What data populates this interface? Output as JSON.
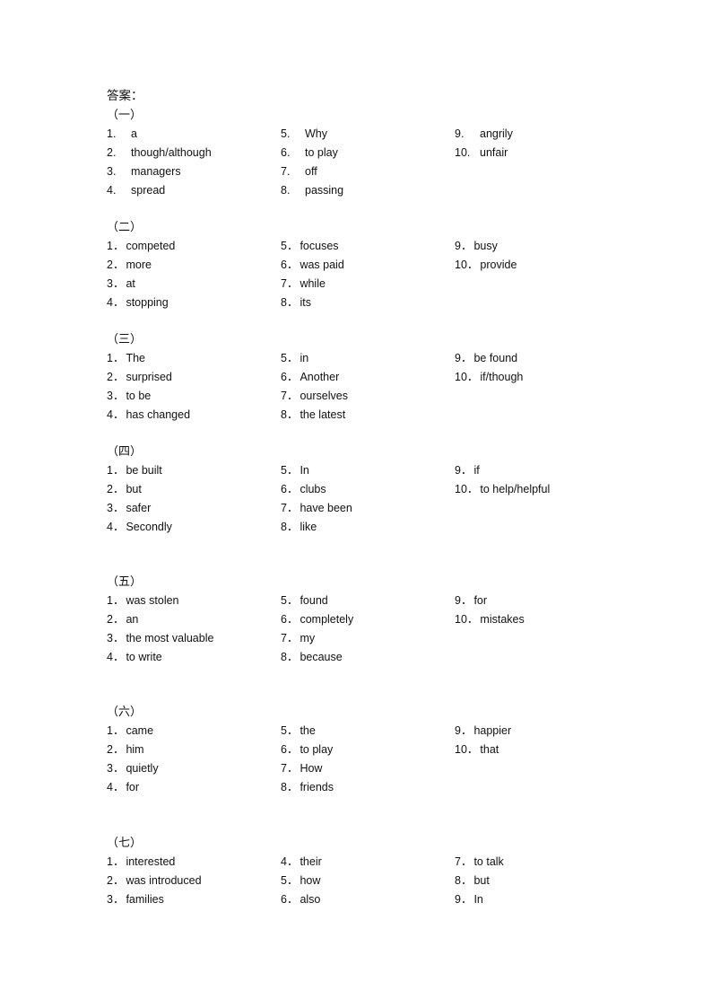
{
  "document": {
    "heading": "答案：",
    "sections": [
      {
        "title": "（一）",
        "style": "A",
        "items": [
          {
            "num": "1.",
            "answer": "a"
          },
          {
            "num": "2.",
            "answer": "though/although"
          },
          {
            "num": "3.",
            "answer": "managers"
          },
          {
            "num": "4.",
            "answer": "spread"
          },
          {
            "num": "5.",
            "answer": "Why"
          },
          {
            "num": "6.",
            "answer": "to play"
          },
          {
            "num": "7.",
            "answer": "off"
          },
          {
            "num": "8.",
            "answer": "passing"
          },
          {
            "num": "9.",
            "answer": "angrily"
          },
          {
            "num": "10.",
            "answer": "unfair"
          }
        ]
      },
      {
        "title": "（二）",
        "style": "B",
        "items": [
          {
            "num": "1．",
            "answer": "competed"
          },
          {
            "num": "2．",
            "answer": "more"
          },
          {
            "num": "3．",
            "answer": "at"
          },
          {
            "num": "4．",
            "answer": "stopping"
          },
          {
            "num": "5．",
            "answer": "focuses"
          },
          {
            "num": "6．",
            "answer": "was paid"
          },
          {
            "num": "7．",
            "answer": "while"
          },
          {
            "num": "8．",
            "answer": "its"
          },
          {
            "num": "9．",
            "answer": "busy"
          },
          {
            "num": "10．",
            "answer": "provide"
          }
        ]
      },
      {
        "title": "（三）",
        "style": "B",
        "items": [
          {
            "num": "1．",
            "answer": "The"
          },
          {
            "num": "2．",
            "answer": "surprised"
          },
          {
            "num": "3．",
            "answer": "to be"
          },
          {
            "num": "4．",
            "answer": "has changed"
          },
          {
            "num": "5．",
            "answer": "in"
          },
          {
            "num": "6．",
            "answer": "Another"
          },
          {
            "num": "7．",
            "answer": "ourselves"
          },
          {
            "num": "8．",
            "answer": "the latest"
          },
          {
            "num": "9．",
            "answer": "be found"
          },
          {
            "num": "10．",
            "answer": "if/though"
          }
        ]
      },
      {
        "title": "（四）",
        "style": "B",
        "items": [
          {
            "num": "1．",
            "answer": "be built"
          },
          {
            "num": "2．",
            "answer": "but"
          },
          {
            "num": "3．",
            "answer": "safer"
          },
          {
            "num": "4．",
            "answer": "Secondly"
          },
          {
            "num": "5．",
            "answer": "In"
          },
          {
            "num": "6．",
            "answer": "clubs"
          },
          {
            "num": "7．",
            "answer": "have been"
          },
          {
            "num": "8．",
            "answer": "like"
          },
          {
            "num": "9．",
            "answer": "if"
          },
          {
            "num": "10．",
            "answer": "to help/helpful"
          }
        ]
      },
      {
        "title": "（五）",
        "style": "B",
        "items": [
          {
            "num": "1．",
            "answer": "was stolen"
          },
          {
            "num": "2．",
            "answer": "an"
          },
          {
            "num": "3．",
            "answer": "the most valuable"
          },
          {
            "num": "4．",
            "answer": "to write"
          },
          {
            "num": "5．",
            "answer": "found"
          },
          {
            "num": "6．",
            "answer": "completely"
          },
          {
            "num": "7．",
            "answer": "my"
          },
          {
            "num": "8．",
            "answer": "because"
          },
          {
            "num": "9．",
            "answer": "for"
          },
          {
            "num": "10．",
            "answer": "mistakes"
          }
        ]
      },
      {
        "title": "（六）",
        "style": "B",
        "items": [
          {
            "num": "1．",
            "answer": "came"
          },
          {
            "num": "2．",
            "answer": "him"
          },
          {
            "num": "3．",
            "answer": "quietly"
          },
          {
            "num": "4．",
            "answer": "for"
          },
          {
            "num": "5．",
            "answer": "the"
          },
          {
            "num": "6．",
            "answer": "to play"
          },
          {
            "num": "7．",
            "answer": "How"
          },
          {
            "num": "8．",
            "answer": "friends"
          },
          {
            "num": "9．",
            "answer": "happier"
          },
          {
            "num": "10．",
            "answer": "that"
          }
        ]
      },
      {
        "title": "（七）",
        "style": "B",
        "items": [
          {
            "num": "1．",
            "answer": "interested"
          },
          {
            "num": "2．",
            "answer": "was introduced"
          },
          {
            "num": "3．",
            "answer": "families"
          },
          {
            "num": "4．",
            "answer": "their"
          },
          {
            "num": "5．",
            "answer": "how"
          },
          {
            "num": "6．",
            "answer": "also"
          },
          {
            "num": "7．",
            "answer": "to talk"
          },
          {
            "num": "8．",
            "answer": "but"
          },
          {
            "num": "9．",
            "answer": "In"
          }
        ]
      }
    ]
  }
}
